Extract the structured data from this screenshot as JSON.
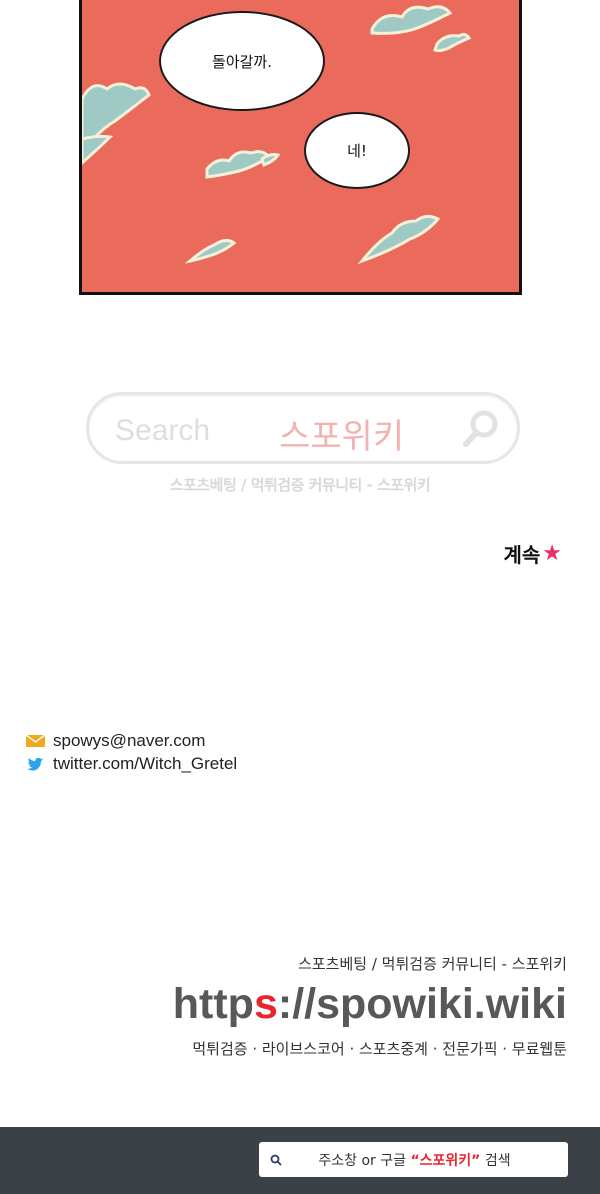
{
  "comic": {
    "bubble_1": "돌아갈까.",
    "bubble_2": "네!"
  },
  "banner": {
    "placeholder": "Search",
    "brand": "스포위키",
    "caption": "스포츠베팅 / 먹튀검증 커뮤니티 - 스포위키"
  },
  "continued": {
    "label": "계속",
    "star": "★"
  },
  "contacts": {
    "email": "spowys@naver.com",
    "twitter": "twitter.com/Witch_Gretel"
  },
  "credit": {
    "line1": "스포츠베팅 / 먹튀검증 커뮤니티 - 스포위키",
    "url_prefix": "http",
    "url_accent": "s",
    "url_suffix": "://spowiki.wiki",
    "line3": "먹튀검증 · 라이브스코어 · 스포츠중계 · 전문가픽 · 무료웹툰"
  },
  "bottom_bar": {
    "pre": "주소창 or 구글 ",
    "brand": "“스포위키”",
    "post": " 검색"
  },
  "colors": {
    "panel_bg": "#ea6a5c",
    "accent_red": "#e8262c",
    "star_pink": "#ea2f66",
    "bar_bg": "#3c4147"
  }
}
